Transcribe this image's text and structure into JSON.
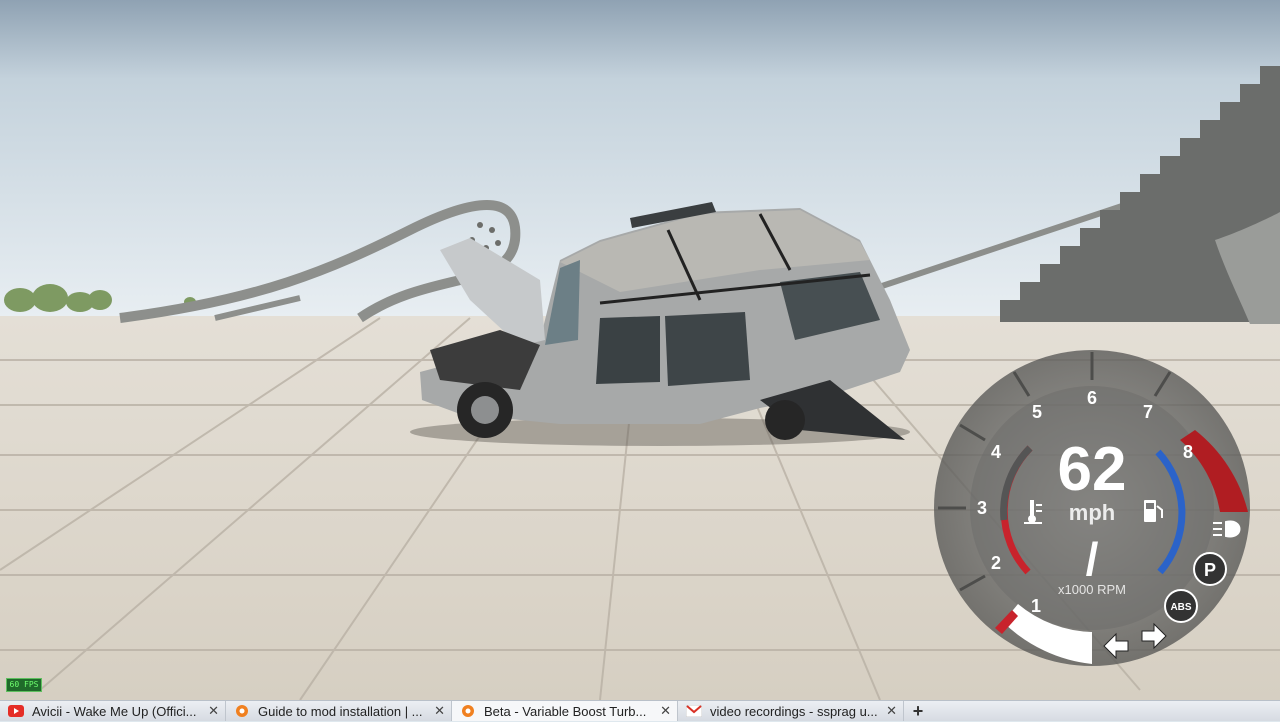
{
  "hud": {
    "speed": "62",
    "speed_unit": "mph",
    "rpm_label": "x1000 RPM",
    "gear": "/",
    "rpm_ticks": [
      "1",
      "2",
      "3",
      "4",
      "5",
      "6",
      "7",
      "8"
    ],
    "fps_label": "60 FPS",
    "colors": {
      "redline": "#b01d22",
      "temp_arc": "#c8232c",
      "fuel_arc": "#2b63c9",
      "needle_fill": "#ffffff"
    }
  },
  "icons": {
    "temp": "thermometer-icon",
    "fuel": "fuel-pump-icon",
    "headlight": "headlight-icon",
    "parking": "parking-brake-icon",
    "abs": "abs-icon",
    "signal_left": "turn-signal-left-icon",
    "signal_right": "turn-signal-right-icon"
  },
  "indicator_labels": {
    "parking": "P",
    "abs": "ABS"
  },
  "tabs": [
    {
      "title": "Avicii - Wake Me Up (Offici...",
      "icon": "youtube-icon",
      "active": false
    },
    {
      "title": "Guide to mod installation | ...",
      "icon": "beamng-icon",
      "active": false
    },
    {
      "title": "Beta - Variable Boost Turb...",
      "icon": "beamng-icon",
      "active": true
    },
    {
      "title": "video recordings - ssprag u...",
      "icon": "gmail-icon",
      "active": false
    }
  ],
  "tab_close": "✕",
  "new_tab": "+"
}
